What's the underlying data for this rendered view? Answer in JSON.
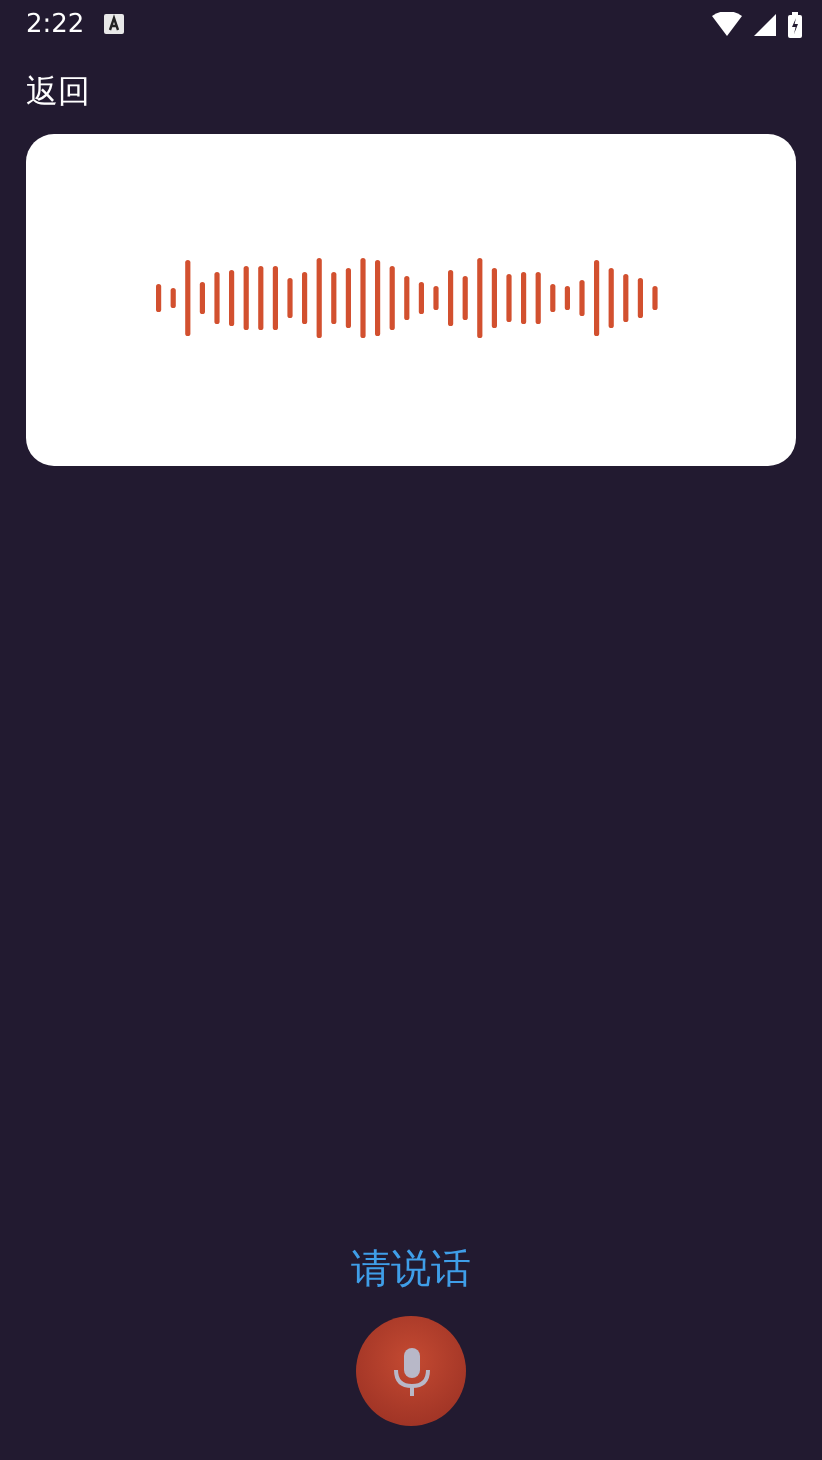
{
  "status_bar": {
    "time": "2:22"
  },
  "back_button": {
    "label": "返回"
  },
  "prompt": "请说话"
}
